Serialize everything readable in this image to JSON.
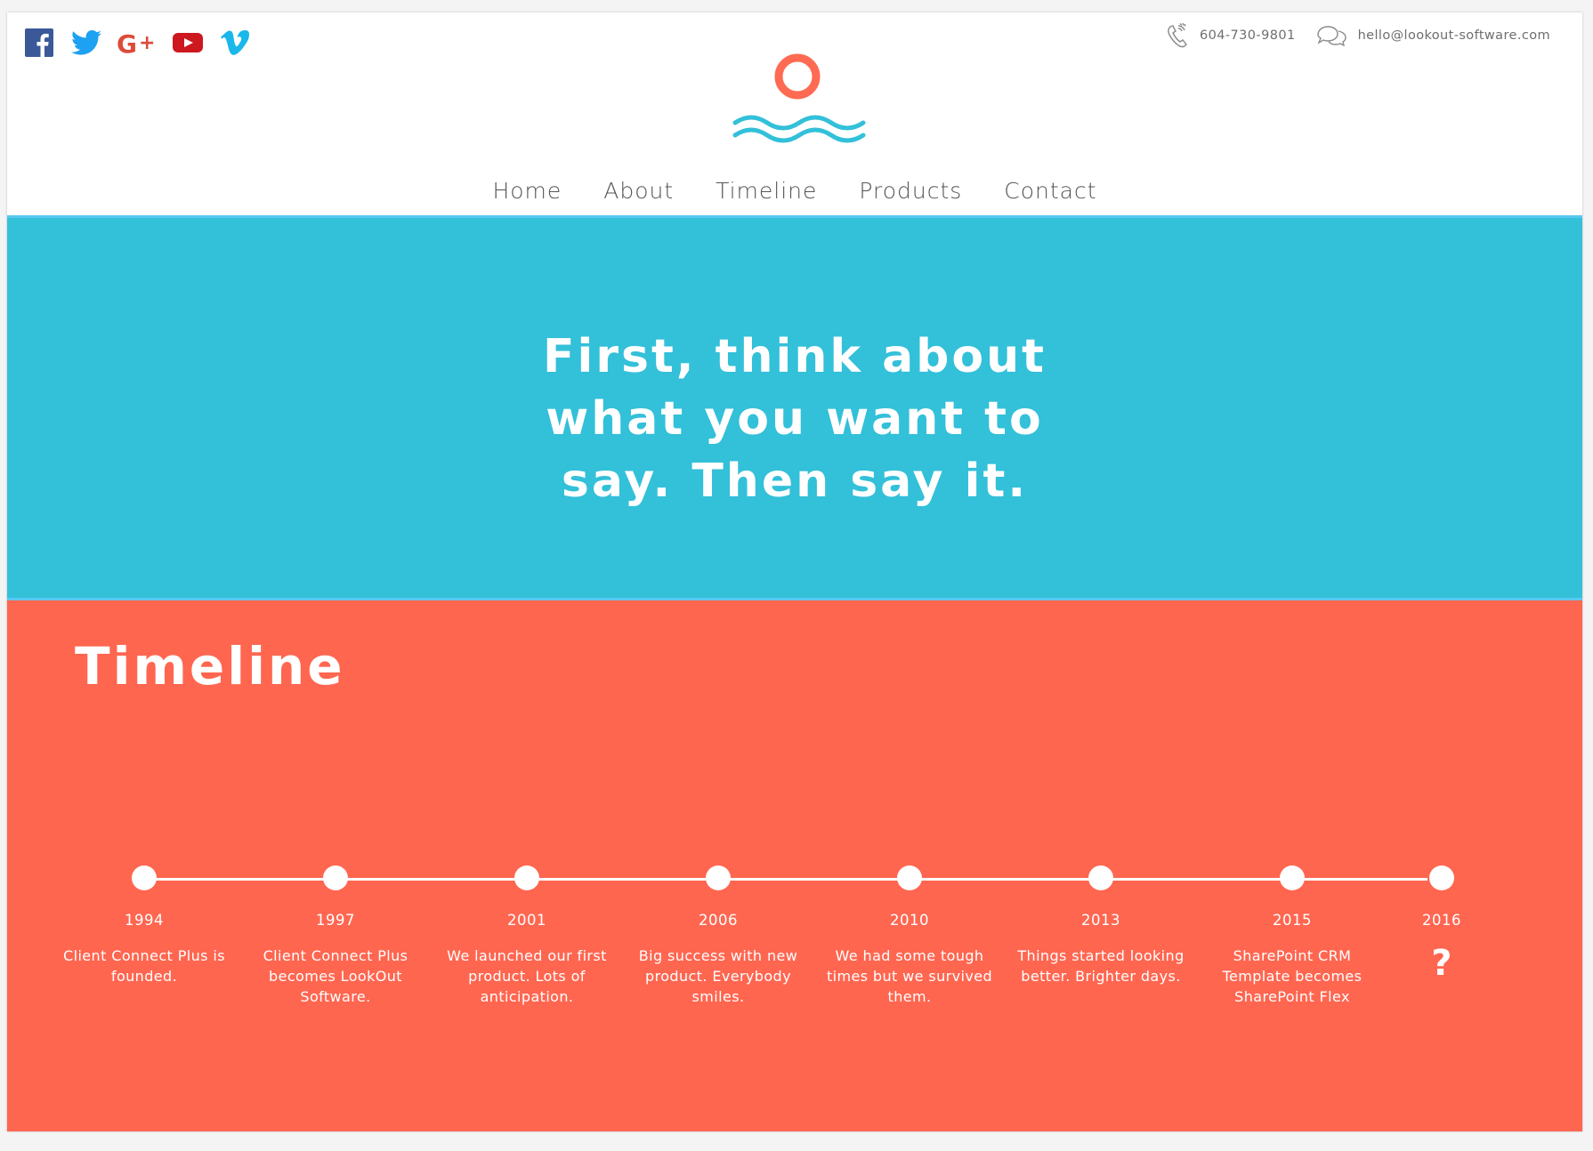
{
  "social": [
    {
      "name": "facebook",
      "icon": "facebook-icon",
      "color": "#3b5998"
    },
    {
      "name": "twitter",
      "icon": "twitter-icon",
      "color": "#1da1f2"
    },
    {
      "name": "google-plus",
      "icon": "google-plus-icon",
      "color": "#dd4b39"
    },
    {
      "name": "youtube",
      "icon": "youtube-icon",
      "color": "#cc181e"
    },
    {
      "name": "vimeo",
      "icon": "vimeo-icon",
      "color": "#1ab7ea"
    }
  ],
  "contact": {
    "phone": "604-730-9801",
    "email": "hello@lookout-software.com",
    "phone_icon": "phone-icon",
    "email_icon": "chat-bubbles-icon"
  },
  "logo": {
    "icon": "sun-over-waves-logo",
    "sun_color": "#fe6b52",
    "wave_color": "#33c0d9"
  },
  "nav": {
    "items": [
      "Home",
      "About",
      "Timeline",
      "Products",
      "Contact"
    ]
  },
  "hero": {
    "lines": [
      "First, think about",
      "what you want to",
      "say. Then say it."
    ],
    "background": "#33c0d9"
  },
  "timeline": {
    "title": "Timeline",
    "background": "#ff6650",
    "events": [
      {
        "year": "1994",
        "desc": "Client Connect Plus is founded."
      },
      {
        "year": "1997",
        "desc": "Client Connect Plus becomes LookOut Software."
      },
      {
        "year": "2001",
        "desc": "We launched our first product. Lots of anticipation."
      },
      {
        "year": "2006",
        "desc": "Big success with new product. Everybody smiles."
      },
      {
        "year": "2010",
        "desc": "We had some tough times but we survived them."
      },
      {
        "year": "2013",
        "desc": "Things started looking better. Brighter days."
      },
      {
        "year": "2015",
        "desc": "SharePoint CRM Template becomes SharePoint Flex"
      },
      {
        "year": "2016",
        "desc": "?"
      }
    ]
  }
}
